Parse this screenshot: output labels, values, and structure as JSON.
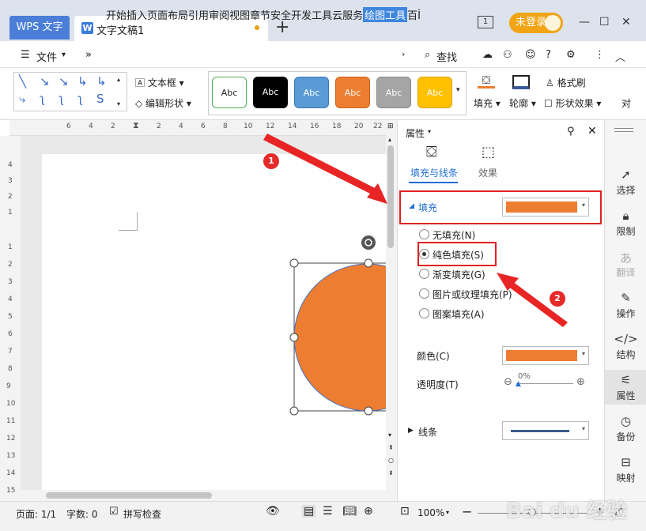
{
  "titlebar": {
    "app_tab": "WPS 文字",
    "doc_icon": "W",
    "doc_tab": "文字文稿1",
    "new_tab": "+",
    "login": "未登录",
    "page_count_icon": "1"
  },
  "menubar": {
    "file": "文件",
    "items": [
      "开始",
      "插入",
      "页面布局",
      "引用",
      "审阅",
      "视图",
      "章节",
      "安全",
      "开发工具",
      "云服务",
      "绘图工具",
      "百İ"
    ],
    "active_index": 10,
    "search": "查找"
  },
  "ribbon": {
    "textbox": "文本框",
    "edit_shape": "编辑形状",
    "style_label": "Abc",
    "fill": "填充",
    "outline": "轮廓",
    "format_painter": "格式刷",
    "shape_effect": "形状效果",
    "more": "对"
  },
  "ruler": {
    "top": [
      "6",
      "4",
      "2",
      "2",
      "4",
      "6",
      "8",
      "10",
      "12",
      "14",
      "16",
      "18",
      "20",
      "22"
    ],
    "left": [
      "4",
      "3",
      "2",
      "1",
      "1",
      "2",
      "3",
      "4",
      "5",
      "6",
      "7",
      "8",
      "9",
      "10",
      "11",
      "12",
      "13",
      "14",
      "15"
    ]
  },
  "panel": {
    "title": "属性",
    "tab_fill": "填充与线条",
    "tab_effect": "效果",
    "fill_section": "填充",
    "options": [
      "无填充(N)",
      "纯色填充(S)",
      "渐变填充(G)",
      "图片或纹理填充(P)",
      "图案填充(A)"
    ],
    "selected_option": 1,
    "color_label": "颜色(C)",
    "transparency_label": "透明度(T)",
    "transparency_value": "0%",
    "line_section": "线条",
    "fill_color": "#ed7d31"
  },
  "sidebar": {
    "items": [
      "选择",
      "限制",
      "翻译",
      "操作",
      "结构",
      "属性",
      "备份",
      "映射"
    ]
  },
  "status": {
    "page": "页面: 1/1",
    "words": "字数: 0",
    "spellcheck": "拼写检查",
    "zoom": "100%"
  },
  "annotations": {
    "badge1": "1",
    "badge2": "2"
  },
  "watermark": "Bai du 经验",
  "colors": {
    "accent": "#3f86de",
    "shape_fill": "#ed7d31",
    "annotation": "#e02020"
  }
}
